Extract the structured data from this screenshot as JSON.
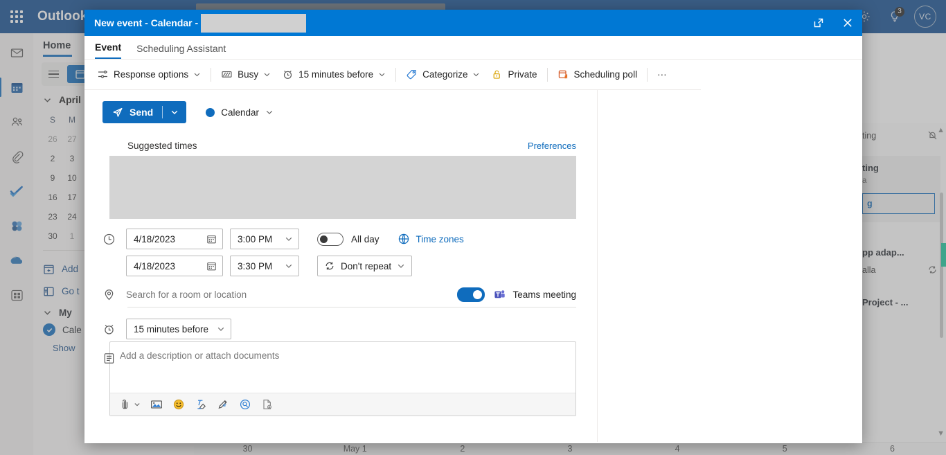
{
  "background": {
    "brand": "Outlook",
    "search_redacted": true,
    "header_icons": [
      {
        "name": "gear-icon"
      },
      {
        "name": "lightbulb-icon",
        "badge": "3"
      }
    ],
    "avatar_initials": "VC",
    "rail_items": [
      {
        "name": "mail-icon",
        "label": "Mail"
      },
      {
        "name": "calendar-icon",
        "label": "Calendar",
        "selected": true
      },
      {
        "name": "people-icon",
        "label": "People"
      },
      {
        "name": "files-icon",
        "label": "Files"
      },
      {
        "name": "todo-icon",
        "label": "To Do"
      },
      {
        "name": "groups-icon",
        "label": "Groups"
      },
      {
        "name": "onedrive-icon",
        "label": "OneDrive"
      },
      {
        "name": "apps-icon",
        "label": "Apps"
      }
    ],
    "home_tab": "Home",
    "mini_calendar": {
      "month": "April",
      "dow": [
        "S",
        "M"
      ],
      "weeks": [
        [
          "26",
          "27"
        ],
        [
          "2",
          "3"
        ],
        [
          "9",
          "10"
        ],
        [
          "16",
          "17"
        ],
        [
          "23",
          "24"
        ],
        [
          "30",
          "1"
        ]
      ]
    },
    "left_links": [
      {
        "label": "Add",
        "icon": "add-calendar-icon"
      },
      {
        "label": "Go t",
        "icon": "go-to-icon"
      }
    ],
    "my_calendars_label": "My ",
    "calendar_item": "Cale",
    "show_link": "Show",
    "day_columns": [
      "30",
      "May 1",
      "2",
      "3",
      "4",
      "5",
      "6"
    ],
    "right_pane": {
      "row1": "ting",
      "card_title": "ting",
      "card_sub": "a",
      "card_button": "g",
      "item2_title": "pp adap...",
      "item2_sub": "alla",
      "item3_title": "Project - ..."
    }
  },
  "dialog": {
    "title": "New event - Calendar -",
    "title_redacted": true,
    "window_buttons": [
      {
        "name": "popout-button",
        "label": "Pop out"
      },
      {
        "name": "close-button",
        "label": "Close"
      }
    ],
    "tabs": [
      {
        "label": "Event",
        "active": true
      },
      {
        "label": "Scheduling Assistant",
        "active": false
      }
    ],
    "toolbar": [
      {
        "label": "Response options",
        "icon": "response-options-icon",
        "caret": true
      },
      {
        "label": "Busy",
        "icon": "busy-icon",
        "caret": true
      },
      {
        "label": "15 minutes before",
        "icon": "reminder-clock-icon",
        "caret": true
      },
      {
        "label": "Categorize",
        "icon": "categorize-tag-icon",
        "caret": true
      },
      {
        "label": "Private",
        "icon": "private-lock-icon",
        "caret": false
      },
      {
        "label": "Scheduling poll",
        "icon": "scheduling-poll-icon",
        "caret": false
      },
      {
        "label": "···",
        "icon": "more-options-icon",
        "caret": false
      }
    ],
    "send_button": "Send",
    "calendar_selector": "Calendar",
    "calendar_color": "#0f6cbd",
    "suggested_times_label": "Suggested times",
    "preferences_link": "Preferences",
    "suggested_times_redacted": true,
    "start_date": "4/18/2023",
    "start_time": "3:00 PM",
    "end_date": "4/18/2023",
    "end_time": "3:30 PM",
    "all_day_label": "All day",
    "all_day_on": false,
    "time_zones_link": "Time zones",
    "repeat_label": "Don't repeat",
    "location_placeholder": "Search for a room or location",
    "teams_meeting_label": "Teams meeting",
    "teams_meeting_on": true,
    "reminder_value": "15 minutes before",
    "description_placeholder": "Add a description or attach documents",
    "description_tools": [
      {
        "name": "attach-icon",
        "caret": true
      },
      {
        "name": "insert-picture-icon",
        "caret": false
      },
      {
        "name": "emoji-icon",
        "caret": false
      },
      {
        "name": "clear-formatting-icon",
        "caret": false
      },
      {
        "name": "ink-draw-icon",
        "caret": false
      },
      {
        "name": "loop-component-icon",
        "caret": false
      },
      {
        "name": "insert-document-icon",
        "caret": false
      }
    ]
  }
}
